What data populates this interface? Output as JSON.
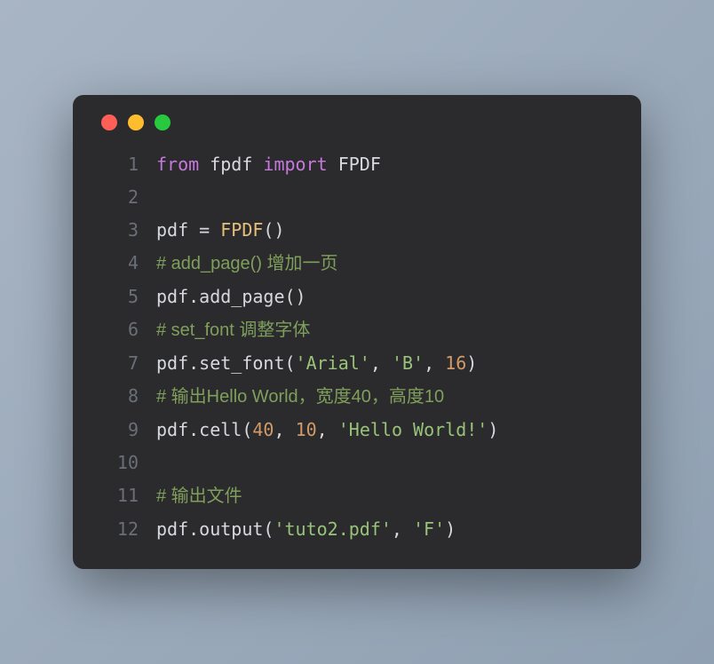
{
  "window": {
    "dots": [
      "red",
      "yellow",
      "green"
    ]
  },
  "code": {
    "lines": [
      {
        "n": "1",
        "tokens": [
          {
            "t": "from",
            "c": "kw"
          },
          {
            "t": " fpdf ",
            "c": "code"
          },
          {
            "t": "import",
            "c": "kw"
          },
          {
            "t": " FPDF",
            "c": "code"
          }
        ]
      },
      {
        "n": "2",
        "tokens": []
      },
      {
        "n": "3",
        "tokens": [
          {
            "t": "pdf = ",
            "c": "code"
          },
          {
            "t": "FPDF",
            "c": "cls"
          },
          {
            "t": "()",
            "c": "code"
          }
        ]
      },
      {
        "n": "4",
        "tokens": [
          {
            "t": "# add_page() 增加一页",
            "c": "com"
          }
        ]
      },
      {
        "n": "5",
        "tokens": [
          {
            "t": "pdf.add_page()",
            "c": "code"
          }
        ]
      },
      {
        "n": "6",
        "tokens": [
          {
            "t": "# set_font 调整字体",
            "c": "com"
          }
        ]
      },
      {
        "n": "7",
        "tokens": [
          {
            "t": "pdf.set_font(",
            "c": "code"
          },
          {
            "t": "'Arial'",
            "c": "str"
          },
          {
            "t": ", ",
            "c": "code"
          },
          {
            "t": "'B'",
            "c": "str"
          },
          {
            "t": ", ",
            "c": "code"
          },
          {
            "t": "16",
            "c": "num"
          },
          {
            "t": ")",
            "c": "code"
          }
        ]
      },
      {
        "n": "8",
        "tokens": [
          {
            "t": "# 输出Hello World，宽度40，高度10",
            "c": "com"
          }
        ]
      },
      {
        "n": "9",
        "tokens": [
          {
            "t": "pdf.cell(",
            "c": "code"
          },
          {
            "t": "40",
            "c": "num"
          },
          {
            "t": ", ",
            "c": "code"
          },
          {
            "t": "10",
            "c": "num"
          },
          {
            "t": ", ",
            "c": "code"
          },
          {
            "t": "'Hello World!'",
            "c": "str"
          },
          {
            "t": ")",
            "c": "code"
          }
        ]
      },
      {
        "n": "10",
        "tokens": []
      },
      {
        "n": "11",
        "tokens": [
          {
            "t": "# 输出文件",
            "c": "com"
          }
        ]
      },
      {
        "n": "12",
        "tokens": [
          {
            "t": "pdf.output(",
            "c": "code"
          },
          {
            "t": "'tuto2.pdf'",
            "c": "str"
          },
          {
            "t": ", ",
            "c": "code"
          },
          {
            "t": "'F'",
            "c": "str"
          },
          {
            "t": ")",
            "c": "code"
          }
        ]
      }
    ]
  }
}
